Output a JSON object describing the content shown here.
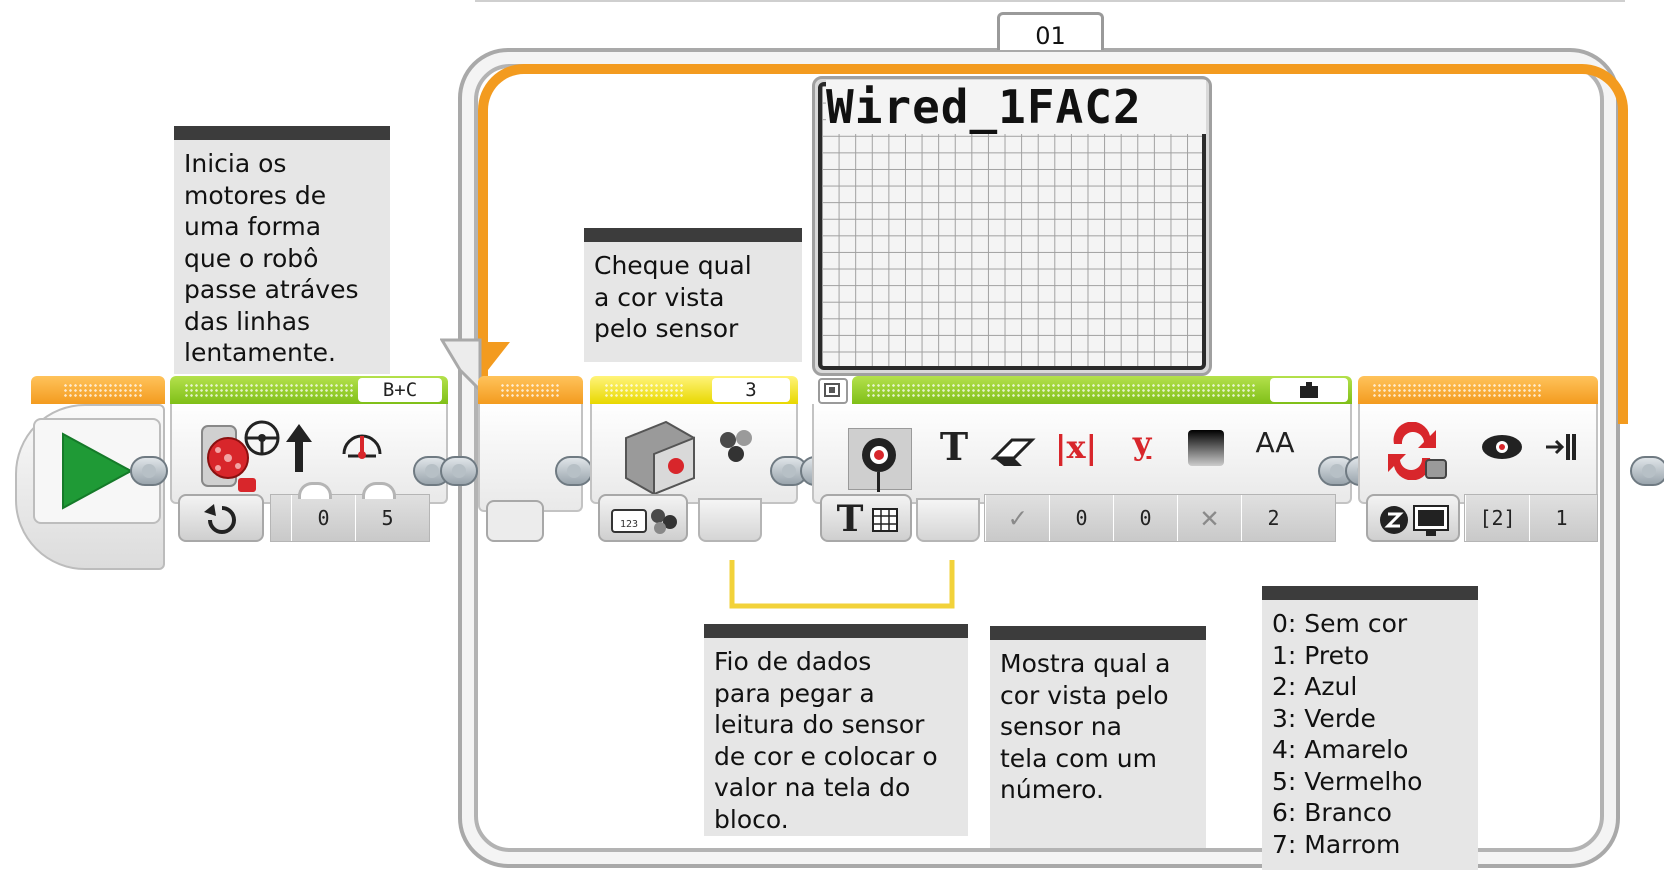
{
  "loop": {
    "label": "01"
  },
  "comments": [
    {
      "id": "motor-comment",
      "text": "Inicia os\nmotores de\numa forma\nque o robô\npasse atráves\ndas linhas\nlentamente."
    },
    {
      "id": "sensor-comment",
      "text": "Cheque qual\na cor vista\npelo sensor"
    },
    {
      "id": "wire-comment",
      "text": "Fio de dados\npara pegar a\nleitura do sensor\nde cor e colocar o\nvalor na tela do\nbloco."
    },
    {
      "id": "display-comment",
      "text": "Mostra qual a\ncor vista pelo\nsensor na\ntela com um\nnúmero."
    },
    {
      "id": "legend-comment",
      "text": "0: Sem cor\n1: Preto\n2: Azul\n3: Verde\n4: Amarelo\n5: Vermelho\n6: Branco\n7: Marrom"
    }
  ],
  "motor_block": {
    "ports": "B+C",
    "params": [
      "0",
      "5"
    ]
  },
  "sensor_block": {
    "port": "3"
  },
  "display_block": {
    "screen_text": "Wired_1FAC2",
    "params": [
      "0",
      "0",
      "2"
    ]
  },
  "bluetooth_block": {
    "params": [
      "[2]",
      "1"
    ]
  },
  "colors": {
    "flow_orange": "#f39b1f",
    "action_green": "#7fbf18",
    "sensor_yellow": "#e8d800",
    "wire_yellow": "#f2d23a",
    "start_green": "#1f9a36",
    "comment_bg": "#e6e6e6",
    "comment_bar": "#3c3c3c"
  },
  "icons": [
    "play-icon",
    "large-motor-icon",
    "steering-icon",
    "arrow-up-icon",
    "speed-gauge-icon",
    "rotate-icon",
    "color-sensor-icon",
    "color-dots-icon",
    "eye-mode-icon",
    "text-icon",
    "eraser-icon",
    "x-coordinate-icon",
    "y-coordinate-icon",
    "color-invert-icon",
    "font-size-icon",
    "check-icon",
    "cancel-x-icon",
    "brick-port-icon",
    "bluetooth-swap-icon",
    "connection-icon",
    "input-arrow-icon",
    "bluetooth-brick-icon",
    "text-grid-mode-icon"
  ]
}
